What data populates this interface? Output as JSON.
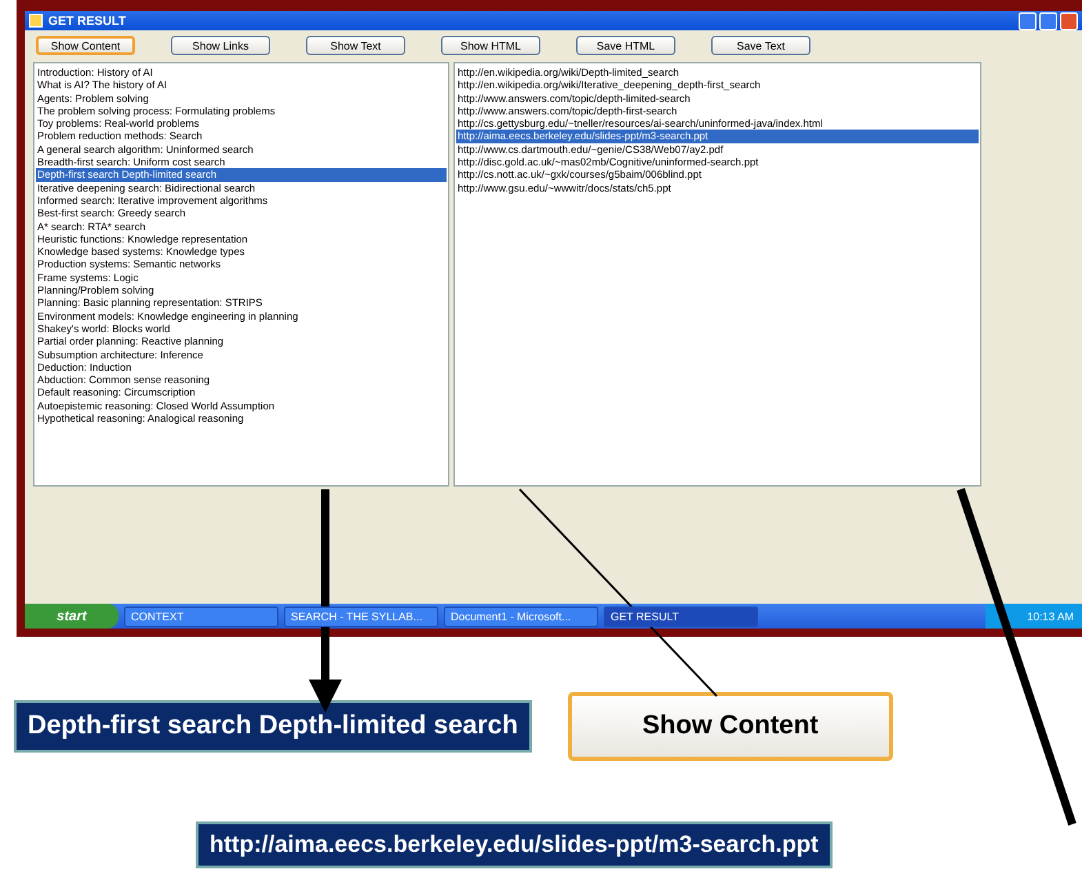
{
  "window": {
    "title": "GET RESULT"
  },
  "buttons": [
    {
      "label": "Show Content",
      "selected": true
    },
    {
      "label": "Show Links",
      "selected": false
    },
    {
      "label": "Show Text",
      "selected": false
    },
    {
      "label": "Show HTML",
      "selected": false
    },
    {
      "label": "Save HTML",
      "selected": false
    },
    {
      "label": "Save Text",
      "selected": false
    }
  ],
  "topics": [
    {
      "label": "Introduction: History of AI",
      "selected": false
    },
    {
      "label": "What is AI? The history of AI",
      "selected": false
    },
    {
      "label": "Agents: Problem solving",
      "selected": false
    },
    {
      "label": "The problem solving process: Formulating problems",
      "selected": false
    },
    {
      "label": "Toy problems: Real-world problems",
      "selected": false
    },
    {
      "label": "Problem reduction methods: Search",
      "selected": false
    },
    {
      "label": "A general search algorithm: Uninformed search",
      "selected": false
    },
    {
      "label": "Breadth-first search: Uniform cost search",
      "selected": false
    },
    {
      "label": "Depth-first search Depth-limited search",
      "selected": true
    },
    {
      "label": "Iterative deepening search: Bidirectional search",
      "selected": false
    },
    {
      "label": "Informed search: Iterative improvement algorithms",
      "selected": false
    },
    {
      "label": "Best-first search: Greedy search",
      "selected": false
    },
    {
      "label": "A* search: RTA* search",
      "selected": false
    },
    {
      "label": "Heuristic functions: Knowledge representation",
      "selected": false
    },
    {
      "label": "Knowledge based systems: Knowledge types",
      "selected": false
    },
    {
      "label": "Production systems: Semantic networks",
      "selected": false
    },
    {
      "label": "Frame systems: Logic",
      "selected": false
    },
    {
      "label": "Planning/Problem solving",
      "selected": false
    },
    {
      "label": " Planning: Basic planning representation: STRIPS",
      "selected": false
    },
    {
      "label": "Environment models: Knowledge engineering in planning",
      "selected": false
    },
    {
      "label": "Shakey's world: Blocks world",
      "selected": false
    },
    {
      "label": "Partial order planning: Reactive planning",
      "selected": false
    },
    {
      "label": "Subsumption architecture: Inference",
      "selected": false
    },
    {
      "label": "Deduction: Induction",
      "selected": false
    },
    {
      "label": "Abduction: Common sense reasoning",
      "selected": false
    },
    {
      "label": "Default reasoning: Circumscription",
      "selected": false
    },
    {
      "label": "Autoepistemic reasoning: Closed World Assumption",
      "selected": false
    },
    {
      "label": "Hypothetical reasoning: Analogical reasoning",
      "selected": false
    }
  ],
  "links": [
    {
      "label": "http://en.wikipedia.org/wiki/Depth-limited_search",
      "selected": false
    },
    {
      "label": "http://en.wikipedia.org/wiki/Iterative_deepening_depth-first_search",
      "selected": false
    },
    {
      "label": "http://www.answers.com/topic/depth-limited-search",
      "selected": false
    },
    {
      "label": "http://www.answers.com/topic/depth-first-search",
      "selected": false
    },
    {
      "label": "http://cs.gettysburg.edu/~tneller/resources/ai-search/uninformed-java/index.html",
      "selected": false
    },
    {
      "label": "http://aima.eecs.berkeley.edu/slides-ppt/m3-search.ppt",
      "selected": true
    },
    {
      "label": "http://www.cs.dartmouth.edu/~genie/CS38/Web07/ay2.pdf",
      "selected": false
    },
    {
      "label": "http://disc.gold.ac.uk/~mas02mb/Cognitive/uninformed-search.ppt",
      "selected": false
    },
    {
      "label": "http://cs.nott.ac.uk/~gxk/courses/g5baim/006blind.ppt",
      "selected": false
    },
    {
      "label": "http://www.gsu.edu/~wwwitr/docs/stats/ch5.ppt",
      "selected": false
    }
  ],
  "taskbar": {
    "start": "start",
    "tasks": [
      {
        "label": "CONTEXT",
        "selected": false
      },
      {
        "label": "SEARCH - THE SYLLAB...",
        "selected": false
      },
      {
        "label": "Document1 - Microsoft...",
        "selected": false
      },
      {
        "label": "GET RESULT",
        "selected": true
      }
    ],
    "clock": "10:13 AM"
  },
  "callouts": {
    "topic": "Depth-first search  Depth-limited search",
    "button": "Show Content",
    "link": "http://aima.eecs.berkeley.edu/slides-ppt/m3-search.ppt"
  }
}
